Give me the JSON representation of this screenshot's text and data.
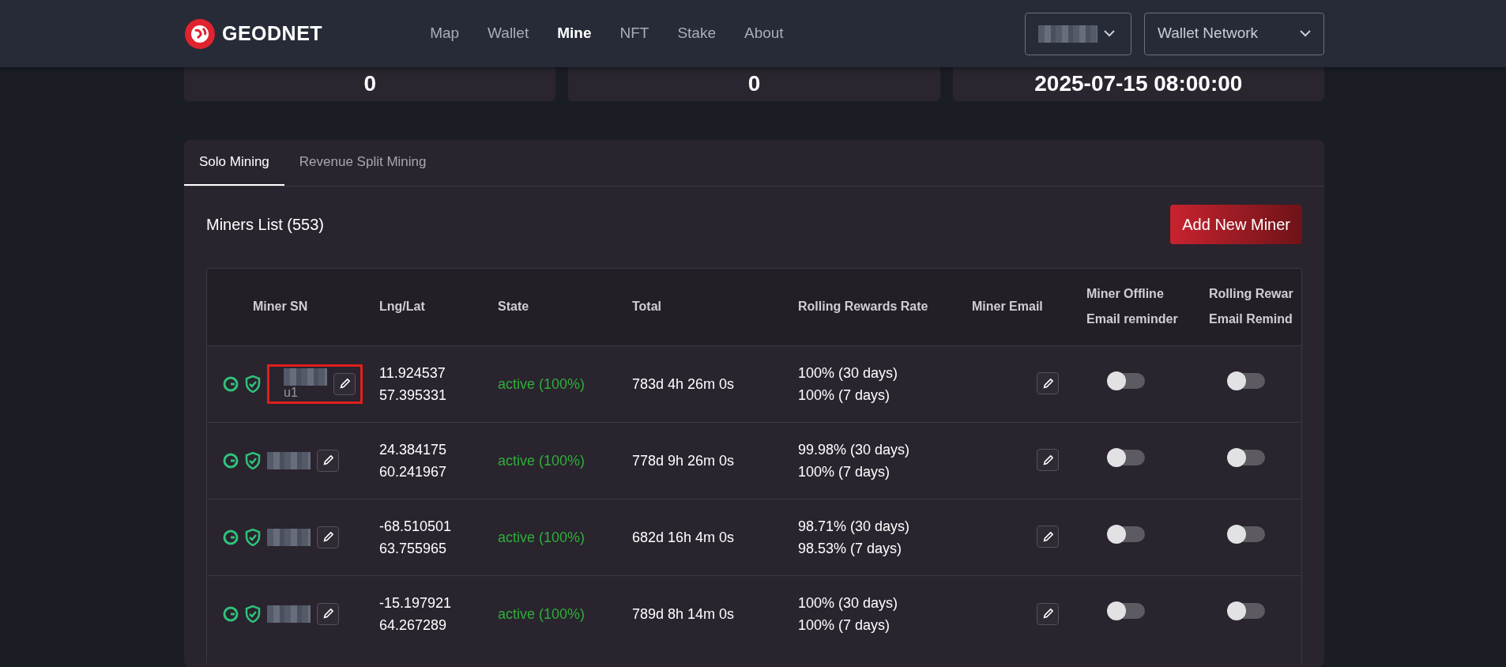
{
  "header": {
    "logo": "GEODNET",
    "nav": [
      {
        "label": "Map",
        "selected": false
      },
      {
        "label": "Wallet",
        "selected": false
      },
      {
        "label": "Mine",
        "selected": true
      },
      {
        "label": "NFT",
        "selected": false
      },
      {
        "label": "Stake",
        "selected": false
      },
      {
        "label": "About",
        "selected": false
      }
    ],
    "network_select": {
      "label": "Wallet Network"
    }
  },
  "stats": [
    {
      "value": "0"
    },
    {
      "value": "0"
    },
    {
      "value": "2025-07-15 08:00:00"
    }
  ],
  "tabs": [
    {
      "label": "Solo Mining",
      "selected": true
    },
    {
      "label": "Revenue Split Mining",
      "selected": false
    }
  ],
  "miners": {
    "title": "Miners List (553)",
    "add_button": "Add New Miner",
    "columns": [
      {
        "lines": [
          "Miner SN"
        ]
      },
      {
        "lines": [
          "Lng/Lat"
        ]
      },
      {
        "lines": [
          "State"
        ]
      },
      {
        "lines": [
          "Total"
        ]
      },
      {
        "lines": [
          "Rolling Rewards Rate"
        ]
      },
      {
        "lines": [
          "Miner Email"
        ]
      },
      {
        "lines": [
          "Miner Offline",
          "Email reminder"
        ]
      },
      {
        "lines": [
          "Rolling Rewar",
          "Email Remind"
        ]
      }
    ],
    "rows": [
      {
        "alias": "u1",
        "highlighted": true,
        "lng": "11.924537",
        "lat": "57.395331",
        "state": "active (100%)",
        "total": "783d 4h 26m 0s",
        "rate_30": "100% (30 days)",
        "rate_7": "100% (7 days)",
        "offline_reminder": false,
        "rolling_reminder": false
      },
      {
        "highlighted": false,
        "lng": "24.384175",
        "lat": "60.241967",
        "state": "active (100%)",
        "total": "778d 9h 26m 0s",
        "rate_30": "99.98% (30 days)",
        "rate_7": "100% (7 days)",
        "offline_reminder": false,
        "rolling_reminder": false
      },
      {
        "highlighted": false,
        "lng": "-68.510501",
        "lat": "63.755965",
        "state": "active (100%)",
        "total": "682d 16h 4m 0s",
        "rate_30": "98.71% (30 days)",
        "rate_7": "98.53% (7 days)",
        "offline_reminder": false,
        "rolling_reminder": false
      },
      {
        "highlighted": false,
        "lng": "-15.197921",
        "lat": "64.267289",
        "state": "active (100%)",
        "total": "789d 8h 14m 0s",
        "rate_30": "100% (30 days)",
        "rate_7": "100% (7 days)",
        "offline_reminder": false,
        "rolling_reminder": false
      }
    ]
  }
}
